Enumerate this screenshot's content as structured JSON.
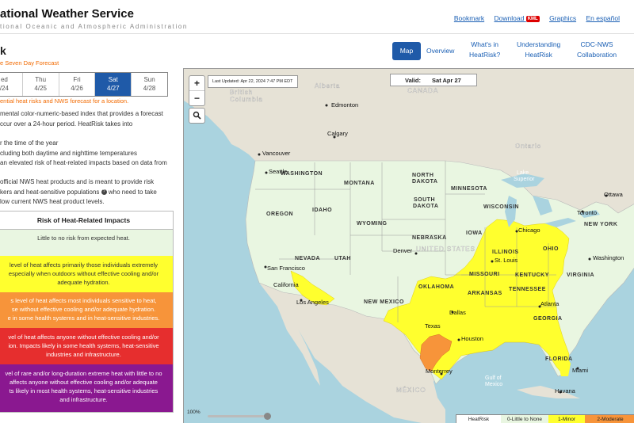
{
  "header": {
    "title": "ational Weather Service",
    "subtitle": "tional Oceanic and Atmospheric Administration",
    "links": {
      "bookmark": "Bookmark",
      "download": "Download",
      "kml": "KML",
      "graphics": "Graphics",
      "spanish": "En español"
    }
  },
  "page": {
    "heading": "k",
    "forecast_label": "e Seven Day Forecast",
    "location_note": "ential heat risks and NWS forecast for a location."
  },
  "days": [
    {
      "name": "ed",
      "date": "/24"
    },
    {
      "name": "Thu",
      "date": "4/25"
    },
    {
      "name": "Fri",
      "date": "4/26"
    },
    {
      "name": "Sat",
      "date": "4/27",
      "selected": true
    },
    {
      "name": "Sun",
      "date": "4/28"
    }
  ],
  "description": {
    "line1": "mental color-numeric-based index that provides a forecast",
    "line2": "ccur over a 24-hour period. HeatRisk takes into",
    "line3": "r the time of the year",
    "line4": "cluding both daytime and nighttime temperatures",
    "line5": "an elevated risk of heat-related impacts based on data from",
    "line6": "official NWS heat products and is meant to provide risk",
    "line7a": "kers and heat-sensitive populations",
    "line7b": "who need to take",
    "line8": "low current NWS heat product levels."
  },
  "risk_table": {
    "header": "Risk of Heat-Related Impacts",
    "rows": [
      {
        "color": "#e9f6e1",
        "text_color": "#333",
        "lines": [
          "Little to no risk from expected heat."
        ]
      },
      {
        "color": "#ffff2e",
        "text_color": "#333",
        "lines": [
          "level of heat affects primarily those individuals extremely",
          "especially when outdoors without effective cooling and/or",
          "adequate hydration."
        ]
      },
      {
        "color": "#f7943a",
        "text_color": "#fff",
        "lines": [
          "s level of heat affects most individuals sensitive to heat,",
          "se without effective cooling and/or adequate hydration.",
          "e in some health systems and in heat-sensitive industries."
        ]
      },
      {
        "color": "#e62e2e",
        "text_color": "#fff",
        "lines": [
          "vel of heat affects anyone without effective cooling and/or",
          "ion. Impacts likely in some health systems, heat-sensitive",
          "industries and infrastructure."
        ]
      },
      {
        "color": "#8a1890",
        "text_color": "#fff",
        "lines": [
          "vel of rare and/or long-duration extreme heat with little to no",
          "affects anyone without effective cooling and/or adequate",
          "ts likely in most health systems, heat-sensitive industries",
          "and infrastructure."
        ]
      }
    ]
  },
  "nav": {
    "map": "Map",
    "overview": "Overview",
    "whats_in_1": "What's in",
    "whats_in_2": "HeatRisk?",
    "und_1": "Understanding",
    "und_2": "HeatRisk",
    "cdc_1": "CDC-NWS",
    "cdc_2": "Collaboration"
  },
  "map": {
    "last_updated": "Last Updated:    Apr 22, 2024 7:47 PM EDT",
    "valid_label": "Valid:",
    "valid_value": "Sat Apr 27",
    "opacity": "100%",
    "zoom_in": "+",
    "zoom_out": "−",
    "legend": [
      {
        "label": "HeatRisk",
        "color": "#ffffff"
      },
      {
        "label": "0-Little to None",
        "color": "#e9f6e1"
      },
      {
        "label": "1-Minor",
        "color": "#ffff2e"
      },
      {
        "label": "2-Moderate",
        "color": "#f7943a"
      }
    ],
    "labels": {
      "alberta": "Alberta",
      "bc1": "British",
      "bc2": "Columbia",
      "canada": "CANADA",
      "ontario": "Ontario",
      "unitedstates": "UNITED STATES",
      "mexico": "MÉXICO",
      "gulf1": "Gulf of",
      "gulf2": "Mexico",
      "lake1": "Lake",
      "lake2": "Superior",
      "wa": "WASHINGTON",
      "mt": "MONTANA",
      "nd1": "NORTH",
      "nd2": "DAKOTA",
      "sd1": "SOUTH",
      "sd2": "DAKOTA",
      "mn": "MINNESOTA",
      "wi": "WISCONSIN",
      "or": "OREGON",
      "id": "IDAHO",
      "wy": "WYOMING",
      "ne": "NEBRASKA",
      "ia": "IOWA",
      "nv": "NEVADA",
      "ut": "UTAH",
      "il": "ILLINOIS",
      "oh": "OHIO",
      "mo": "MISSOURI",
      "ky": "KENTUCKY",
      "va": "VIRGINIA",
      "ca": "California",
      "ok": "OKLAHOMA",
      "nm": "NEW MEXICO",
      "ar": "ARKANSAS",
      "tn": "TENNESSEE",
      "tx": "Texas",
      "ga": "GEORGIA",
      "fl": "FLORIDA",
      "ny": "NEW YORK",
      "edmonton": "Edmonton",
      "calgary": "Calgary",
      "vancouver": "Vancouver",
      "seattle": "Seattle",
      "ottawa": "Ottawa",
      "toronto": "Toronto",
      "chicago": "Chicago",
      "denver": "Denver",
      "sf": "San Francisco",
      "stl": "St. Louis",
      "washington": "Washington",
      "la": "Los Angeles",
      "atlanta": "Atlanta",
      "dallas": "Dallas",
      "houston": "Houston",
      "monterrey": "Monterrey",
      "miami": "Miami",
      "havana": "Havana"
    }
  }
}
